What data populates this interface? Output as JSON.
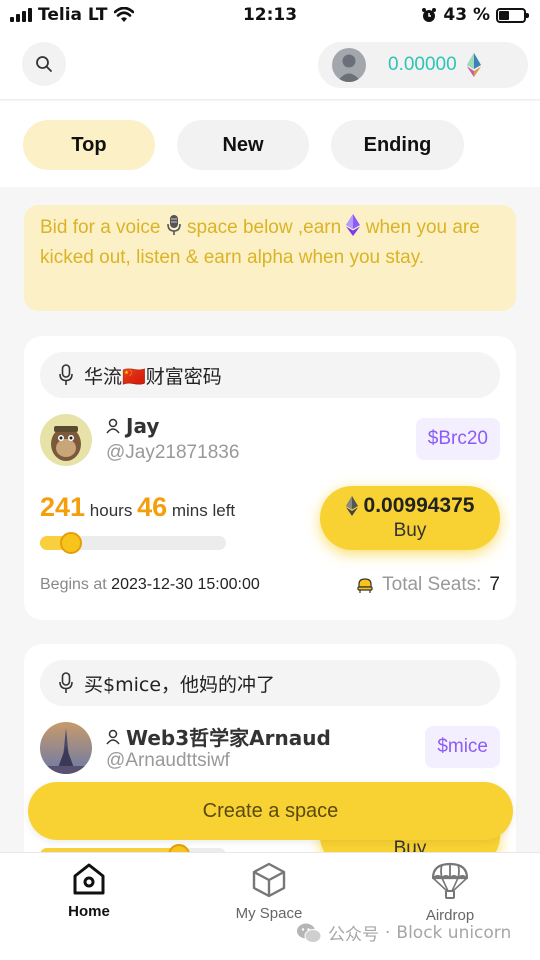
{
  "status_bar": {
    "carrier": "Telia LT",
    "time": "12:13",
    "battery": "43 %",
    "battery_level": 0.43
  },
  "header": {
    "balance": "0.00000",
    "accent_color": "#2ec4b6"
  },
  "tabs": [
    {
      "label": "Top",
      "active": true
    },
    {
      "label": "New",
      "active": false
    },
    {
      "label": "Ending",
      "active": false
    }
  ],
  "notice": {
    "part1": "Bid for a voice",
    "part2": "space below ,earn",
    "part3": "when you are kicked out, listen & earn alpha when you stay."
  },
  "spaces": [
    {
      "title": "华流",
      "title_flag": "🇨🇳",
      "title_rest": "财富密码",
      "host_name": "Jay",
      "host_handle": "@Jay21871836",
      "token": "$Brc20",
      "hours": "241",
      "hours_unit": "hours",
      "mins": "46",
      "mins_unit": "mins left",
      "progress": 0.2,
      "price": "0.00994375",
      "buy_label": "Buy",
      "begins_label": "Begins at",
      "begins_at": "2023-12-30 15:00:00",
      "seats_label": "Total Seats:",
      "seats": "7"
    },
    {
      "title": "买$mice，他妈的冲了",
      "host_name": "Web3哲学家Arnaud",
      "host_handle": "@Arnaudttsiwf",
      "token": "$mice",
      "buy_label": "Buy"
    }
  ],
  "create_button": "Create a space",
  "bottom_nav": [
    {
      "label": "Home",
      "icon": "home-icon",
      "active": true
    },
    {
      "label": "My Space",
      "icon": "cube-icon",
      "active": false
    },
    {
      "label": "Airdrop",
      "icon": "parachute-icon",
      "active": false
    }
  ],
  "watermark": {
    "text1": "公众号",
    "sep": "·",
    "text2": "Block unicorn"
  }
}
